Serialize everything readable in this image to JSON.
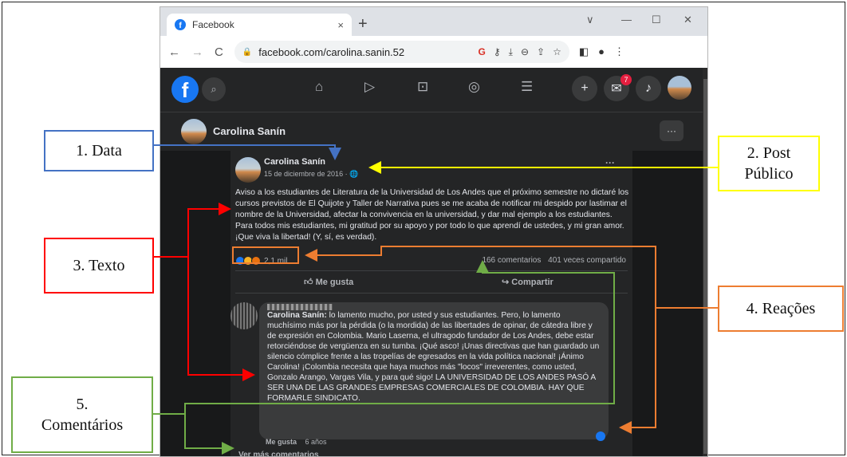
{
  "browser": {
    "tab_title": "Facebook",
    "tab_close": "×",
    "new_tab": "+",
    "url": "facebook.com/carolina.sanin.52",
    "google_icon": "G"
  },
  "facebook": {
    "notification_count": "7",
    "page_name": "Carolina Sanín",
    "more_button": "···"
  },
  "post": {
    "author": "Carolina Sanín",
    "date": "15 de diciembre de 2016 ·",
    "privacy_icon": "globe-icon",
    "menu": "···",
    "text": "Aviso a los estudiantes de Literatura de la Universidad de Los Andes que el próximo semestre no dictaré los cursos previstos de El Quijote y Taller de Narrativa pues se me acaba de notificar mi despido por lastimar el nombre de la Universidad, afectar la convivencia en la universidad, y dar mal ejemplo a los estudiantes. Para todos mis estudiantes, mi gratitud por su apoyo y por todo lo que aprendí de ustedes, y mi gran amor. ¡Que viva la libertad! (Y, sí, es verdad).",
    "reactions_count": "2,1 mil",
    "comments_count": "166 comentarios",
    "shares_count": "401 veces compartido",
    "like_label": "Me gusta",
    "share_label": "Compartir"
  },
  "comment": {
    "author": "Carolina Sanín:",
    "text": " lo lamento mucho, por usted y sus estudiantes. Pero, lo lamento muchísimo más por la pérdida (o la mordida) de las libertades de opinar, de cátedra libre y de expresión en Colombia. Mario Laserna, el ultragodo fundador de Los Andes, debe estar retorciéndose de vergüenza en su tumba. ¡Qué asco! ¡Unas directivas que han guardado un silencio cómplice frente a las tropelías de egresados en la vida política nacional! ¡Ánimo Carolina! ¡Colombia necesita que haya muchos más \"locos\" irreverentes, como usted, Gonzalo Arango, Vargas Vila, y para qué sigo! LA UNIVERSIDAD DE LOS ANDES PASÓ A SER UNA DE LAS GRANDES EMPRESAS COMERCIALES DE COLOMBIA. HAY QUE FORMARLE SINDICATO.",
    "like_label": "Me gusta",
    "age": "6 años",
    "more_comments": "Ver más comentarios"
  },
  "annotations": {
    "data": "1. Data",
    "post_publico": "2. Post\nPúblico",
    "texto": "3. Texto",
    "reacoes": "4. Reações",
    "comentarios": "5.\nComentários"
  },
  "colors": {
    "blue": "#4472c4",
    "yellow": "#ffff00",
    "red": "#ff0000",
    "orange": "#ed7d31",
    "green": "#70ad47"
  }
}
